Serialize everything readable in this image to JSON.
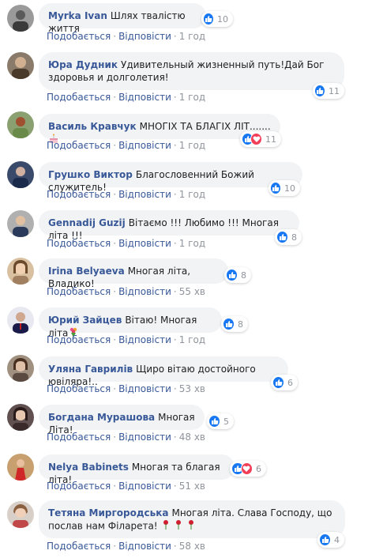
{
  "ui": {
    "like_label": "Подобається",
    "reply_label": "Відповісти",
    "separator": "·"
  },
  "comments": [
    {
      "name": "Myrka Ivan",
      "text": "Шлях твалістю життя",
      "time": "1 год",
      "reactions": [
        "like"
      ],
      "reaction_count": "10",
      "avatar_color": "#7a7a7a"
    },
    {
      "name": "Юра Дудник",
      "text": "Удивительный жизненный путь!Дай Бог здоровья и долголетия!",
      "time": "1 год",
      "reactions": [
        "like"
      ],
      "reaction_count": "11",
      "avatar_color": "#5a4a3a"
    },
    {
      "name": "Василь Кравчук",
      "text": "МНОГІХ ТА БЛАГІХ ЛІТ.......",
      "text_emoji": "cake-emoji",
      "time": "1 год",
      "reactions": [
        "like",
        "love"
      ],
      "reaction_count": "11",
      "avatar_color": "#6b8a5a"
    },
    {
      "name": "Грушко Виктор",
      "text": "Благословенний Божий служитель!",
      "time": "1 год",
      "reactions": [
        "like"
      ],
      "reaction_count": "10",
      "avatar_color": "#2a3a5a"
    },
    {
      "name": "Gennadij Guzij",
      "text": "Вітаємо !!! Любимо !!! Многая літа !!!",
      "time": "1 год",
      "reactions": [
        "like"
      ],
      "reaction_count": "8",
      "avatar_color": "#8a8a8a"
    },
    {
      "name": "Irina Belyaeva",
      "text": "Многая літа, Владико!",
      "time": "55 хв",
      "reactions": [
        "like"
      ],
      "reaction_count": "8",
      "avatar_color": "#b89070"
    },
    {
      "name": "Юрий Зайцев",
      "text": "Вітаю! Многая літа",
      "text_emoji": "bouquet-emoji",
      "time": "1 год",
      "reactions": [
        "like"
      ],
      "reaction_count": "8",
      "avatar_color": "#3a3a6a"
    },
    {
      "name": "Уляна Гаврилів",
      "text": "Щиро вітаю достойного ювіляра!..",
      "time": "53 хв",
      "reactions": [
        "like"
      ],
      "reaction_count": "6",
      "avatar_color": "#6a5a4a"
    },
    {
      "name": "Богдана Мурашова",
      "text": "Многая Літа!",
      "time": "48 хв",
      "reactions": [
        "like"
      ],
      "reaction_count": "5",
      "avatar_color": "#4a3a3a"
    },
    {
      "name": "Nelya Babinets",
      "text": "Многая та благая літа!",
      "time": "51 хв",
      "reactions": [
        "like",
        "love"
      ],
      "reaction_count": "6",
      "avatar_color": "#c04040"
    },
    {
      "name": "Тетяна Миргородська",
      "text": "Многая літа. Слава Господу, що послав нам Філарета!",
      "text_emoji": "roses-emoji",
      "time": "58 хв",
      "reactions": [
        "like"
      ],
      "reaction_count": "4",
      "avatar_color": "#c09080"
    }
  ]
}
